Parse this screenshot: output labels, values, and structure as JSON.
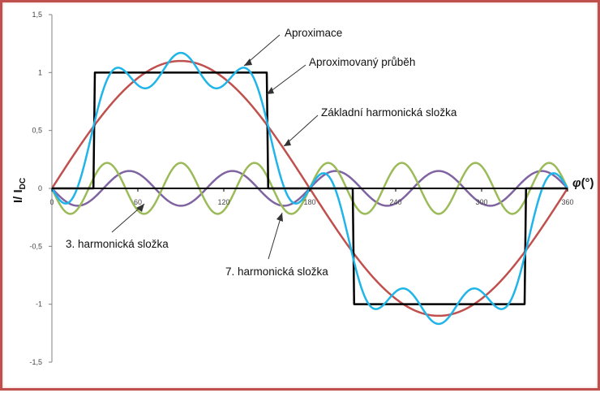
{
  "chart_data": {
    "type": "line",
    "x": {
      "min": 0,
      "max": 360,
      "ticks": [
        "0",
        "60",
        "120",
        "180",
        "240",
        "300",
        "360"
      ],
      "unit_label": "(°)",
      "symbol": "φ"
    },
    "y": {
      "min": -1.5,
      "max": 1.5,
      "ticks": [
        "1,5",
        "1",
        "0,5",
        "0",
        "-0,5",
        "-1",
        "-1,5"
      ],
      "label_main": "I/ I",
      "label_sub": "DC"
    },
    "grid": false,
    "series": [
      {
        "name": "Aproximovaný průběh",
        "color": "#000000",
        "kind": "square",
        "amplitude": 1,
        "transitions": [
          30,
          150,
          210,
          330
        ]
      },
      {
        "name": "Základní harmonická složka",
        "color": "#c0504d",
        "kind": "sine",
        "amplitude": 1.1,
        "harmonic": 1
      },
      {
        "name": "3. harmonická složka",
        "color": "#8064a2",
        "kind": "sine",
        "amplitude": 0.15,
        "harmonic": 5,
        "phase_sign": -1
      },
      {
        "name": "7. harmonická složka",
        "color": "#9bbb59",
        "kind": "sine",
        "amplitude": 0.22,
        "harmonic": 7,
        "phase_sign": -1
      },
      {
        "name": "Aproximace",
        "color": "#1fb5e8",
        "kind": "sum",
        "of": [
          1,
          2,
          3
        ]
      }
    ],
    "annotations": [
      {
        "text": "Aproximace",
        "target": "Aproximace"
      },
      {
        "text": "Aproximovaný průběh",
        "target": "Aproximovaný průběh"
      },
      {
        "text": "Základní harmonická složka",
        "target": "Základní harmonická složka"
      },
      {
        "text": "3. harmonická složka",
        "target": "3. harmonická složka"
      },
      {
        "text": "7. harmonická složka",
        "target": "7. harmonická složka"
      }
    ]
  }
}
